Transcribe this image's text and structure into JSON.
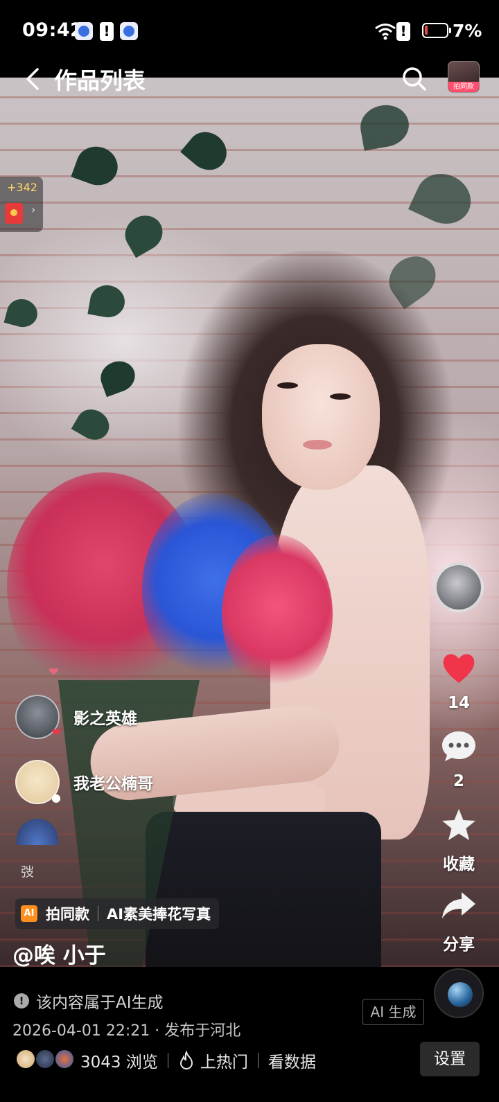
{
  "status_bar": {
    "time": "09:42",
    "battery_percent": "7%",
    "battery_level": 0.07,
    "icons": [
      "app-notification-icon",
      "alert-icon",
      "app-notification-icon",
      "wifi-icon",
      "alert-icon",
      "battery-icon"
    ]
  },
  "header": {
    "title": "作品列表",
    "back_icon": "back-arrow-icon",
    "search_icon": "search-icon",
    "pai_tag": "拍同款"
  },
  "red_packet": {
    "count": "+342",
    "arrow": "›"
  },
  "actions": {
    "like_count": "14",
    "comment_count": "2",
    "favorite_label": "收藏",
    "share_label": "分享",
    "colors": {
      "like": "#f0344a"
    }
  },
  "comments": [
    {
      "name": "影之英雄",
      "badge": "❤"
    },
    {
      "name": "我老公楠哥",
      "badge": "●"
    }
  ],
  "small_char": "弢",
  "template": {
    "ai_icon": "AI",
    "same_label": "拍同款",
    "name": "AI素美捧花写真"
  },
  "post": {
    "author": "@唉 小于",
    "ai_notice": "该内容属于AI生成",
    "notice_icon": "!",
    "date_location": "2026-04-01 22:21 · 发布于河北",
    "ai_badge": "AI 生成"
  },
  "stats": {
    "views": "3043 浏览",
    "hot": "上热门",
    "data": "看数据",
    "settings": "设置"
  }
}
